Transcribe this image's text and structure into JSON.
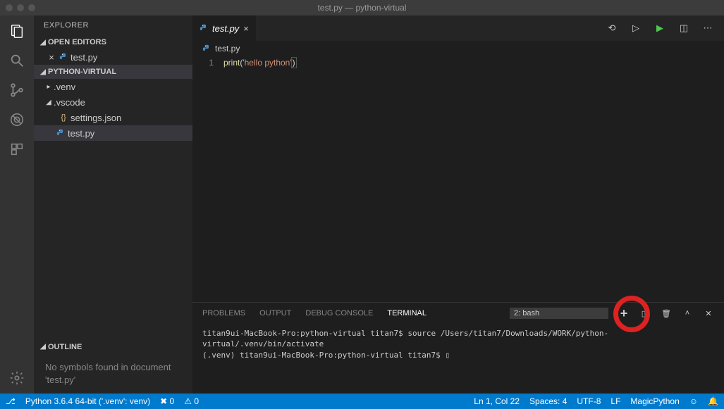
{
  "window": {
    "title": "test.py — python-virtual"
  },
  "sidebar": {
    "title": "EXPLORER",
    "openEditors": {
      "label": "OPEN EDITORS",
      "files": [
        {
          "name": "test.py"
        }
      ]
    },
    "workspace": {
      "label": "PYTHON-VIRTUAL",
      "items": [
        {
          "name": ".venv",
          "type": "folder",
          "expanded": false
        },
        {
          "name": ".vscode",
          "type": "folder",
          "expanded": true,
          "children": [
            {
              "name": "settings.json",
              "type": "json"
            }
          ]
        },
        {
          "name": "test.py",
          "type": "py",
          "selected": true
        }
      ]
    },
    "outline": {
      "label": "OUTLINE",
      "body": "No symbols found in document 'test.py'"
    }
  },
  "editor": {
    "tab": {
      "name": "test.py"
    },
    "breadcrumb": {
      "name": "test.py"
    },
    "code": {
      "lineNum": "1",
      "fn": "print",
      "open": "(",
      "str": "'hello python'",
      "close": ")"
    }
  },
  "panel": {
    "tabs": {
      "problems": "PROBLEMS",
      "output": "OUTPUT",
      "debug": "DEBUG CONSOLE",
      "terminal": "TERMINAL"
    },
    "terminalSelect": "2: bash",
    "terminalLines": "titan9ui-MacBook-Pro:python-virtual titan7$ source /Users/titan7/Downloads/WORK/python-virtual/.venv/bin/activate\n(.venv) titan9ui-MacBook-Pro:python-virtual titan7$ ▯"
  },
  "status": {
    "branch": "⎇",
    "python": "Python 3.6.4 64-bit ('.venv': venv)",
    "err": "✖ 0",
    "warn": "⚠ 0",
    "lncol": "Ln 1, Col 22",
    "spaces": "Spaces: 4",
    "enc": "UTF-8",
    "eol": "LF",
    "lang": "MagicPython",
    "smile": "☺",
    "bell": "🔔"
  }
}
